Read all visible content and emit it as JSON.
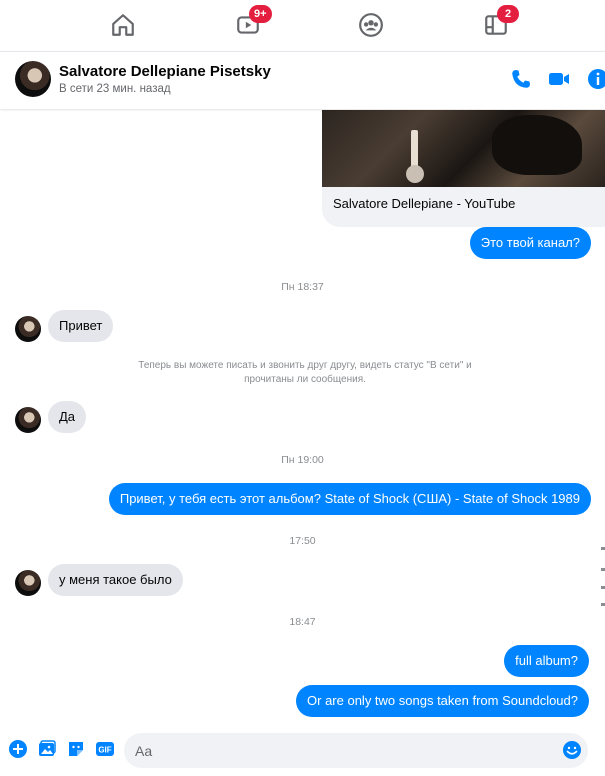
{
  "nav": {
    "home_icon": "home-icon",
    "watch_icon": "video-icon",
    "watch_badge": "9+",
    "groups_icon": "groups-icon",
    "gaming_icon": "gaming-icon",
    "gaming_badge": "2"
  },
  "header": {
    "name": "Salvatore Dellepiane Pisetsky",
    "status": "В сети 23 мин. назад",
    "actions": [
      "phone-icon",
      "video-camera-icon",
      "info-icon"
    ]
  },
  "messages": {
    "link_title": "Salvatore Dellepiane - YouTube",
    "m1": "Это твой канал?",
    "sep1": "Пн 18:37",
    "m2": "Привет",
    "notice": "Теперь вы можете писать и звонить друг другу, видеть статус \"В сети\" и прочитаны ли сообщения.",
    "m3": "Да",
    "sep2": "Пн 19:00",
    "m4": "Привет, у тебя есть этот альбом? State of Shock (США) - State of Shock 1989",
    "sep3": "17:50",
    "m5": "у меня такое было",
    "sep4": "18:47",
    "m6": "full album?",
    "m7": "Or are only two songs taken from Soundcloud?"
  },
  "composer": {
    "placeholder": "Aa",
    "icons": [
      "plus-icon",
      "photo-icon",
      "sticker-icon",
      "gif-icon",
      "emoji-icon"
    ],
    "gif_label": "GIF"
  },
  "colors": {
    "accent": "#0084ff",
    "incoming_bubble": "#e4e6eb",
    "badge": "#e41e3f"
  }
}
